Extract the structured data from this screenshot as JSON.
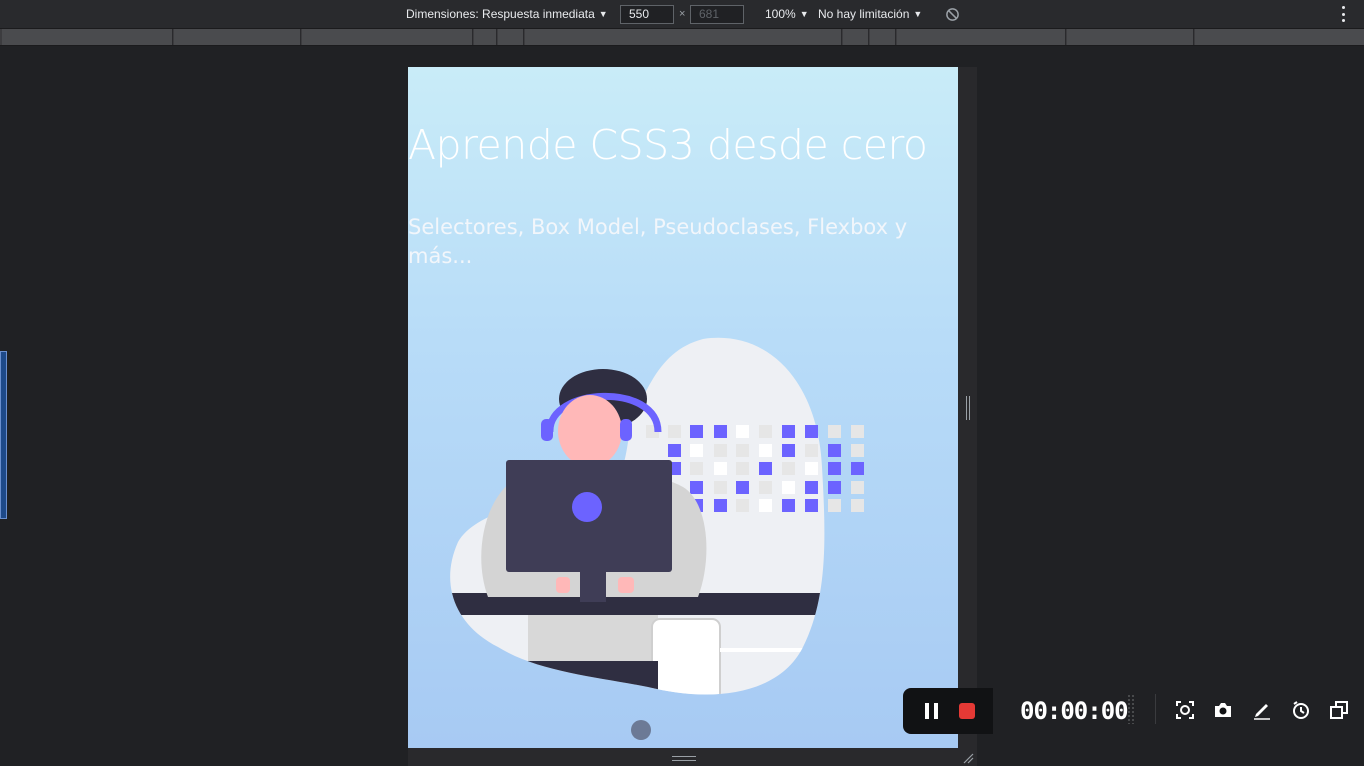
{
  "device_toolbar": {
    "dimensions_label": "Dimensiones: Respuesta inmediata",
    "width_value": "550",
    "times_symbol": "×",
    "height_value": "681",
    "zoom": "100%",
    "throttling": "No hay limitación",
    "icons": {
      "caret": "▼",
      "rotate": "rotate-icon",
      "more": "more-options-icon"
    }
  },
  "page": {
    "title": "Aprende CSS3 desde cero",
    "subtitle": "Selectores, Box Model, Pseudoclases, Flexbox y más..."
  },
  "recorder": {
    "timer": "00:00:00",
    "icons": [
      "pause-icon",
      "stop-icon",
      "region-capture-icon",
      "camera-icon",
      "pen-icon",
      "timer-icon",
      "window-icon"
    ]
  },
  "colors": {
    "accent_purple": "#6c63ff",
    "stop_red": "#e53935",
    "devtools_bg": "#202124"
  }
}
